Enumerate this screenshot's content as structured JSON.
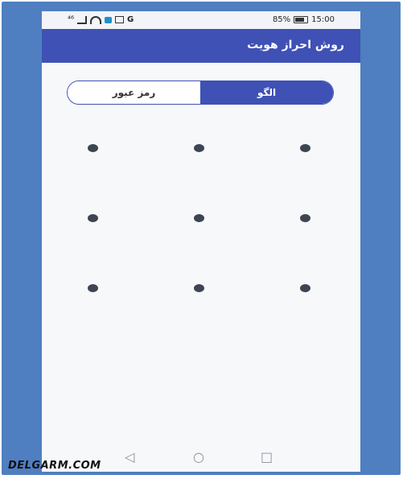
{
  "status_bar": {
    "carrier_label": "⁴⁶",
    "battery": "85%",
    "time": "15:00",
    "app_letter": "G"
  },
  "app_bar": {
    "title": "روش احراز هویت"
  },
  "toggle": {
    "pattern_label": "الگو",
    "password_label": "رمز عبور",
    "selected": "pattern"
  },
  "pattern_grid": {
    "rows": 3,
    "cols": 3
  },
  "nav": {
    "back_icon": "back-triangle-icon",
    "home_icon": "home-circle-icon",
    "recent_icon": "recent-square-icon"
  },
  "watermark": "DELGARM.COM",
  "colors": {
    "accent": "#3f51b5",
    "frame": "#4f7fc0",
    "dot": "#3d4452"
  }
}
